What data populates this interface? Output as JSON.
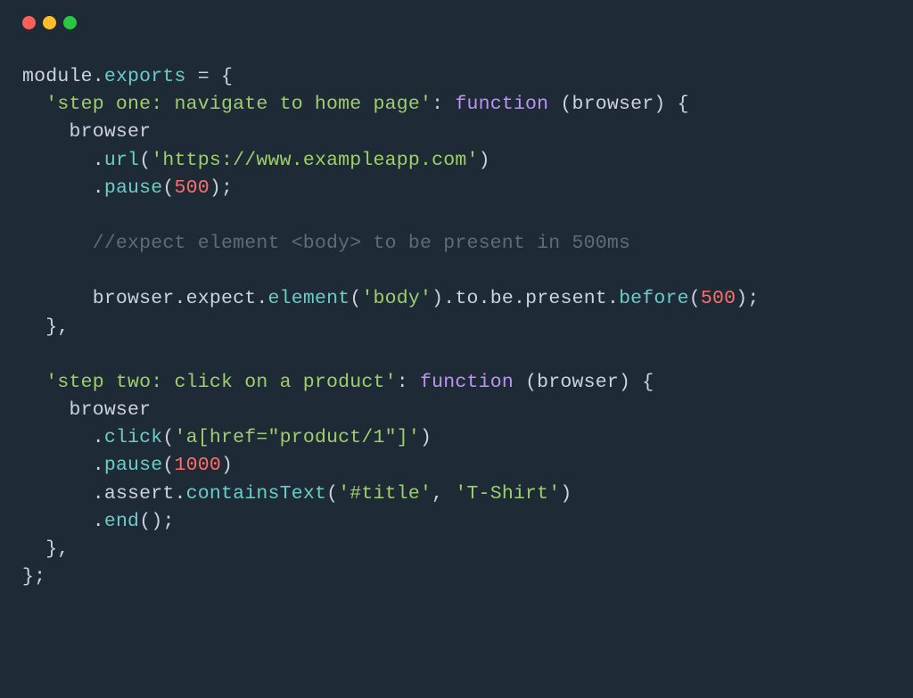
{
  "titleBar": {
    "red": "",
    "yellow": "",
    "green": ""
  },
  "tokens": {
    "module": "module",
    "dot": ".",
    "exports": "exports",
    "sp": " ",
    "eq": "=",
    "lbrace": "{",
    "rbrace": "}",
    "lparen": "(",
    "rparen": ")",
    "semi": ";",
    "comma": ",",
    "colon": ":",
    "indent1": "  ",
    "indent2": "    ",
    "indent3": "      ",
    "step1_key": "'step one: navigate to home page'",
    "function": "function",
    "browser_param": "(browser)",
    "browser": "browser",
    "url": "url",
    "url_arg": "'https://www.exampleapp.com'",
    "pause": "pause",
    "n500": "500",
    "comment1": "//expect element <body> to be present in 500ms",
    "expect": "expect",
    "element": "element",
    "body_arg": "'body'",
    "to": "to",
    "be": "be",
    "present": "present",
    "before": "before",
    "step2_key": "'step two: click on a product'",
    "click": "click",
    "click_arg": "'a[href=\"product/1\"]'",
    "n1000": "1000",
    "assert": "assert",
    "containsText": "containsText",
    "title_arg": "'#title'",
    "tshirt_arg": "'T-Shirt'",
    "end": "end",
    "comma_sp": ", "
  }
}
